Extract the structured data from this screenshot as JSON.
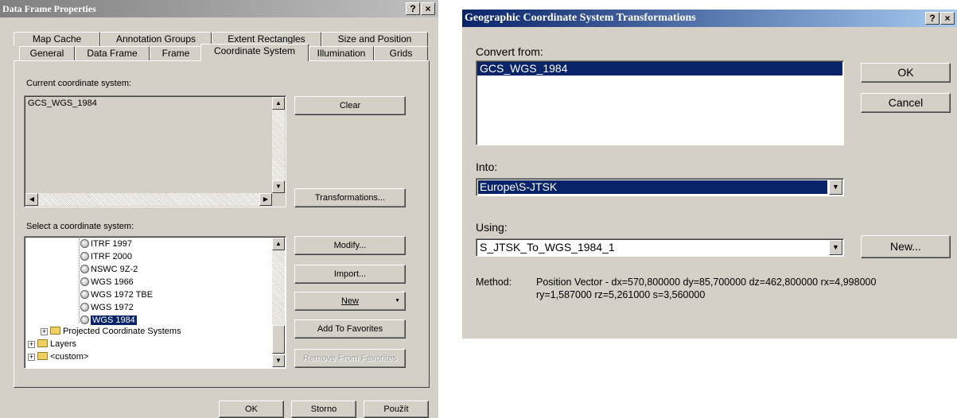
{
  "dlg1": {
    "title": "Data Frame Properties",
    "help": "?",
    "close": "×",
    "tabs_back": [
      "Map Cache",
      "Annotation Groups",
      "Extent Rectangles",
      "Size and Position"
    ],
    "tabs_front": [
      "General",
      "Data Frame",
      "Frame",
      "Coordinate System",
      "Illumination",
      "Grids"
    ],
    "current_label": "Current coordinate system:",
    "current_value": "GCS_WGS_1984",
    "clear": "Clear",
    "transformations": "Transformations...",
    "select_label": "Select a coordinate system:",
    "tree": [
      "ITRF 1997",
      "ITRF 2000",
      "NSWC 9Z-2",
      "WGS 1966",
      "WGS 1972 TBE",
      "WGS 1972",
      "WGS 1984"
    ],
    "tree_folders": [
      "Projected Coordinate Systems",
      "Layers",
      "<custom>"
    ],
    "modify": "Modify...",
    "import": "Import...",
    "new": "New",
    "add_favorites": "Add To Favorites",
    "remove_favorites": "Remove From Favorites",
    "ok": "OK",
    "storno": "Storno",
    "pouzit": "Použít"
  },
  "dlg2": {
    "title": "Geographic Coordinate System Transformations",
    "help": "?",
    "close": "×",
    "convert_from_label": "Convert from:",
    "convert_from_item": "GCS_WGS_1984",
    "ok": "OK",
    "cancel": "Cancel",
    "into_label": "Into:",
    "into_value": "Europe\\S-JTSK",
    "using_label": "Using:",
    "using_value": "S_JTSK_To_WGS_1984_1",
    "new": "New...",
    "method_label": "Method:",
    "method_line1": "Position Vector - dx=570,800000 dy=85,700000 dz=462,800000 rx=4,998000",
    "method_line2": "ry=1,587000 rz=5,261000 s=3,560000"
  },
  "colors": {
    "selection": "#0a246a",
    "face": "#d4d0c8"
  }
}
